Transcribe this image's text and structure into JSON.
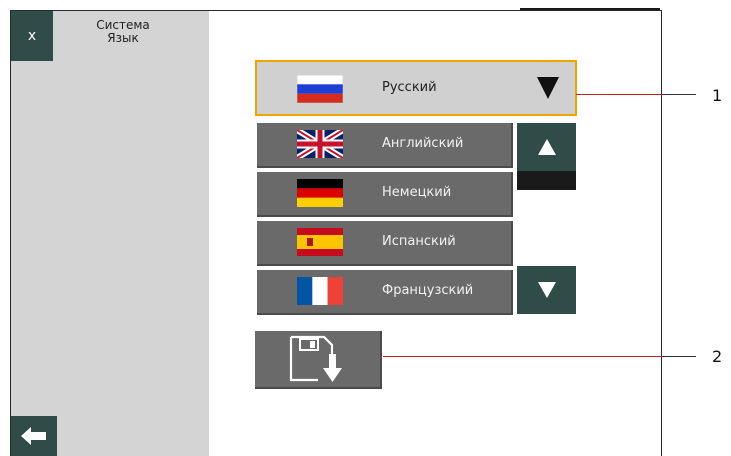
{
  "close_button": {
    "label": "x"
  },
  "breadcrumb": {
    "line1": "Система",
    "line2": "Язык"
  },
  "language_dropdown": {
    "selected": {
      "label": "Русский",
      "flag": "russia-flag"
    },
    "options": [
      {
        "label": "Английский",
        "flag": "uk-flag"
      },
      {
        "label": "Немецкий",
        "flag": "germany-flag"
      },
      {
        "label": "Испанский",
        "flag": "spain-flag"
      },
      {
        "label": "Французский",
        "flag": "france-flag"
      }
    ]
  },
  "callouts": {
    "one": "1",
    "two": "2"
  },
  "icons": {
    "back": "back-arrow-icon",
    "save": "save-icon",
    "scroll_up": "arrow-up-icon",
    "scroll_down": "arrow-down-icon"
  },
  "colors": {
    "button_teal": "#2f4c48",
    "selection_outline": "#f0a400",
    "list_item": "#6a6a6a",
    "sidebar": "#d4d4d4",
    "callout_line": "#b22222"
  }
}
